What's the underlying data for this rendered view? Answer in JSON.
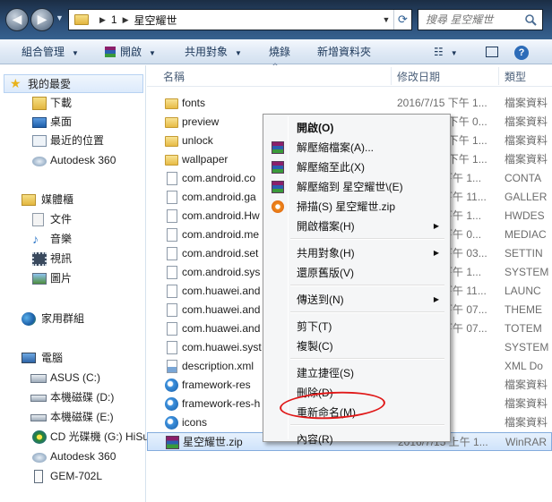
{
  "address": {
    "crumbs": [
      "1",
      "星空耀世"
    ],
    "search_placeholder": "搜尋 星空耀世"
  },
  "toolbar": {
    "organize": "組合管理",
    "open": "開啟",
    "share": "共用對象",
    "burn": "燒錄",
    "new_folder": "新增資料夾"
  },
  "sidebar": {
    "favorites_header": "我的最愛",
    "favorites": [
      "下載",
      "桌面",
      "最近的位置",
      "Autodesk 360"
    ],
    "libraries_header": "媒體櫃",
    "libraries": [
      "文件",
      "音樂",
      "視訊",
      "圖片"
    ],
    "homegroup": "家用群組",
    "computer_header": "電腦",
    "computer": [
      "ASUS (C:)",
      "本機磁碟 (D:)",
      "本機磁碟 (E:)",
      "CD 光碟機 (G:) HiSu",
      "Autodesk 360",
      "GEM-702L"
    ]
  },
  "columns": {
    "name": "名稱",
    "date": "修改日期",
    "type": "類型"
  },
  "files": [
    {
      "name": "fonts",
      "date": "2016/7/15 下午 1...",
      "type": "檔案資料",
      "icon": "folder-icon"
    },
    {
      "name": "preview",
      "date": "2016/7/15 下午 0...",
      "type": "檔案資料",
      "icon": "folder-icon"
    },
    {
      "name": "unlock",
      "date": "2016/7/15 下午 1...",
      "type": "檔案資料",
      "icon": "folder-icon"
    },
    {
      "name": "wallpaper",
      "date": "2016/7/15 下午 1...",
      "type": "檔案資料",
      "icon": "folder-icon"
    },
    {
      "name": "com.android.co",
      "date": "016/7/15 下午 1...",
      "type": "CONTA",
      "icon": "file-icon"
    },
    {
      "name": "com.android.ga",
      "date": "016/7/15 下午 11...",
      "type": "GALLER",
      "icon": "file-icon"
    },
    {
      "name": "com.android.Hw",
      "date": "016/7/15 下午 1...",
      "type": "HWDES",
      "icon": "file-icon"
    },
    {
      "name": "com.android.me",
      "date": "016/7/15 下午 0...",
      "type": "MEDIAC",
      "icon": "file-icon"
    },
    {
      "name": "com.android.set",
      "date": "016/7/15 下午 03...",
      "type": "SETTIN",
      "icon": "file-icon"
    },
    {
      "name": "com.android.sys",
      "date": "016/7/15 下午 1...",
      "type": "SYSTEM",
      "icon": "file-icon"
    },
    {
      "name": "com.huawei.and",
      "date": "016/7/15 下午 11...",
      "type": "LAUNC",
      "icon": "file-icon"
    },
    {
      "name": "com.huawei.and",
      "date": "016/7/15 下午 07...",
      "type": "THEME",
      "icon": "file-icon"
    },
    {
      "name": "com.huawei.and",
      "date": "016/7/15 下午 07...",
      "type": "TOTEM",
      "icon": "file-icon"
    },
    {
      "name": "com.huawei.syst",
      "date": "4 下午 1...",
      "type": "SYSTEM",
      "icon": "file-icon"
    },
    {
      "name": "description.xml",
      "date": "下午 1...",
      "type": "XML Do",
      "icon": "xml-icon"
    },
    {
      "name": "framework-res",
      "date": "下午 1...",
      "type": "檔案資料",
      "icon": "ie-file-icon"
    },
    {
      "name": "framework-res-h",
      "date": "下午 0...",
      "type": "檔案資料",
      "icon": "ie-file-icon"
    },
    {
      "name": "icons",
      "date": "下午 1...",
      "type": "檔案資料",
      "icon": "ie-file-icon"
    },
    {
      "name": "星空耀世.zip",
      "date": "2016/7/15 上午 1...",
      "type": "WinRAR",
      "icon": "winrar-icon"
    }
  ],
  "context_menu": {
    "items": [
      {
        "label": "開啟(O)",
        "bold": true
      },
      {
        "label": "解壓縮檔案(A)...",
        "icon": "winrar-icon"
      },
      {
        "label": "解壓縮至此(X)",
        "icon": "winrar-icon"
      },
      {
        "label": "解壓縮到 星空耀世\\(E)",
        "icon": "winrar-icon"
      },
      {
        "label": "掃描(S) 星空耀世.zip",
        "icon": "antivirus-icon"
      },
      {
        "label": "開啟檔案(H)",
        "submenu": true
      },
      {
        "label": "共用對象(H)",
        "submenu": true
      },
      {
        "label": "還原舊版(V)"
      },
      {
        "label": "傳送到(N)",
        "submenu": true
      },
      {
        "label": "剪下(T)"
      },
      {
        "label": "複製(C)"
      },
      {
        "label": "建立捷徑(S)"
      },
      {
        "label": "刪除(D)"
      },
      {
        "label": "重新命名(M)"
      },
      {
        "label": "內容(R)"
      }
    ]
  },
  "colors": {
    "accent": "#2c4f78",
    "annotation_circle": "#e01818",
    "selection": "#cfe3fb"
  }
}
